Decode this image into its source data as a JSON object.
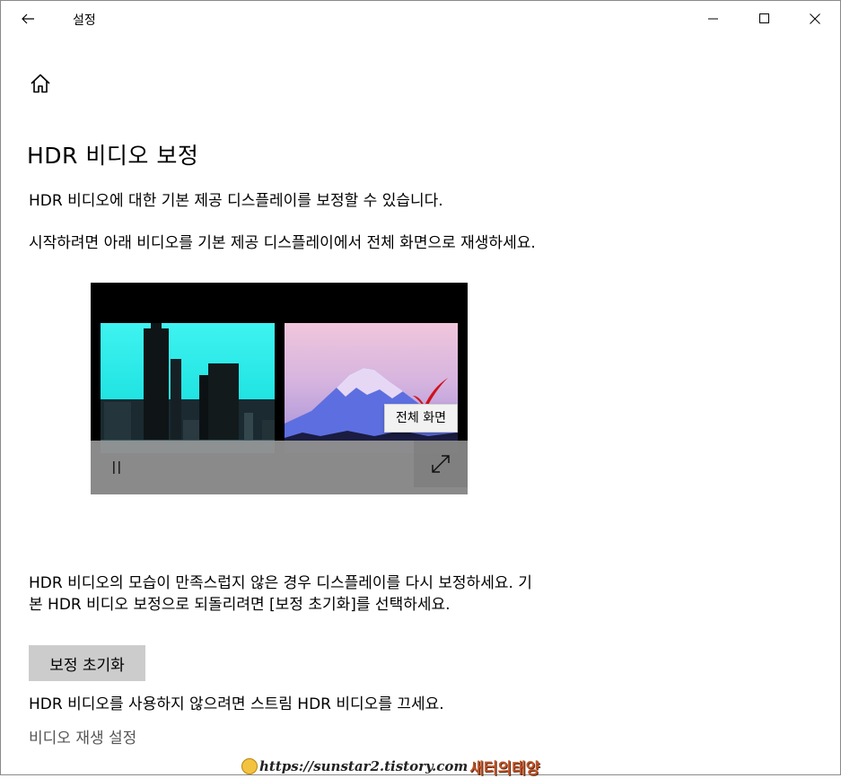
{
  "window": {
    "title": "설정",
    "icons": {
      "back": "back-arrow-icon",
      "minimize": "minimize-icon",
      "maximize": "maximize-icon",
      "close": "close-icon",
      "home": "home-icon"
    }
  },
  "page": {
    "title": "HDR 비디오 보정",
    "intro_paragraph": "HDR 비디오에 대한 기본 제공 디스플레이를 보정할 수 있습니다.",
    "instruction_paragraph": "시작하려면 아래 비디오를 기본 제공 디스플레이에서 전체 화면으로 재생하세요.",
    "video": {
      "fullscreen_tooltip": "전체 화면",
      "controls": {
        "pause": "pause-icon",
        "fullscreen": "fullscreen-expand-icon"
      },
      "annotation": "red-checkmark-icon"
    },
    "reset_paragraph": "HDR 비디오의 모습이 만족스럽지 않은 경우 디스플레이를 다시 보정하세요. 기본 HDR 비디오 보정으로 되돌리려면 [보정 초기화]를 선택하세요.",
    "reset_button_label": "보정 초기화",
    "disable_paragraph": "HDR 비디오를 사용하지 않으려면 스트림 HDR 비디오를 끄세요.",
    "playback_settings_link": "비디오 재생 설정"
  },
  "watermark": {
    "url": "https://sunstar2.tistory.com",
    "brand": "새터의태양"
  },
  "colors": {
    "button_bg": "#cccccc",
    "link_text": "#555555",
    "city_sky": "#3ff3f0",
    "mountain_sky": "#f0c6dc",
    "check_mark": "#d0121b"
  }
}
